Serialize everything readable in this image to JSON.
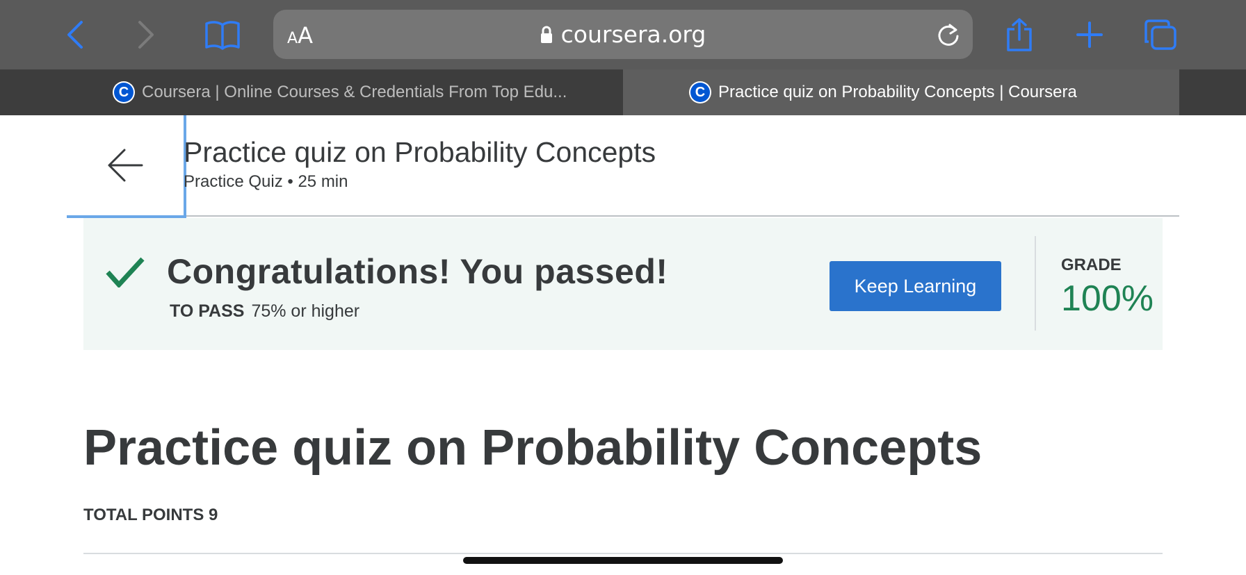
{
  "browser": {
    "url_text": "coursera.org",
    "text_size_control": {
      "small": "A",
      "large": "A"
    },
    "icons": [
      "back-icon",
      "forward-icon",
      "bookmarks-icon",
      "lock-icon",
      "reload-icon",
      "share-icon",
      "new-tab-icon",
      "tabs-icon"
    ],
    "accent_color": "#2f7cf6",
    "tabs": [
      {
        "title": "Coursera | Online Courses & Credentials From Top Edu...",
        "favicon": "C",
        "active": false
      },
      {
        "title": "Practice quiz on Probability Concepts | Coursera",
        "favicon": "C",
        "active": true
      }
    ]
  },
  "header": {
    "title": "Practice quiz on Probability Concepts",
    "subtitle": "Practice Quiz • 25 min"
  },
  "result": {
    "message": "Congratulations! You passed!",
    "to_pass_label": "TO PASS",
    "to_pass_value": "75% or higher",
    "button_label": "Keep Learning",
    "grade_label": "GRADE",
    "grade_value": "100%",
    "success_color": "#1f8354",
    "button_color": "#2a73cc"
  },
  "main": {
    "title": "Practice quiz on Probability Concepts",
    "total_points": "TOTAL POINTS 9"
  }
}
